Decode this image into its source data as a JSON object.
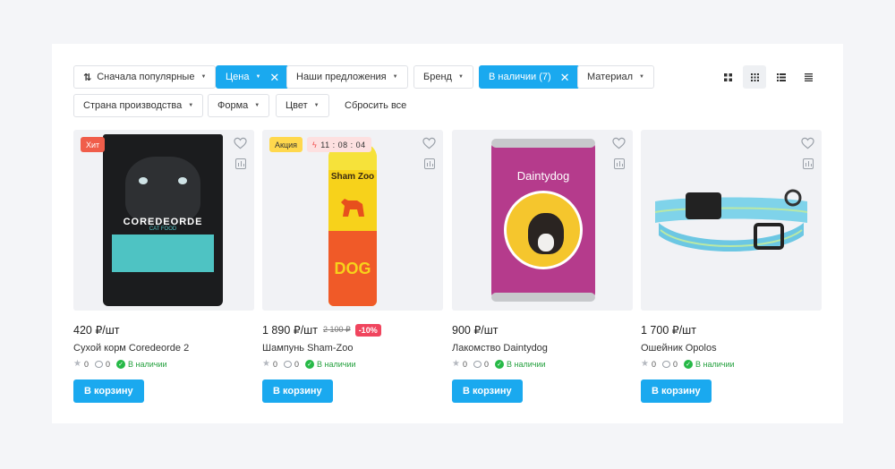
{
  "filters": {
    "sort": {
      "label": "Сначала популярные"
    },
    "price": {
      "label": "Цена"
    },
    "offers": {
      "label": "Наши предложения"
    },
    "brand": {
      "label": "Бренд"
    },
    "stock": {
      "label": "В наличии (7)"
    },
    "material": {
      "label": "Материал"
    },
    "country": {
      "label": "Страна производства"
    },
    "shape": {
      "label": "Форма"
    },
    "color": {
      "label": "Цвет"
    },
    "reset": {
      "label": "Сбросить все"
    }
  },
  "view_modes": [
    "grid-large-icon",
    "grid-small-icon",
    "list-icon",
    "table-icon"
  ],
  "products": [
    {
      "badge": "Хит",
      "price": "420 ₽/шт",
      "name": "Сухой корм Coredeorde 2",
      "rating": "0",
      "reviews": "0",
      "availability": "В наличии",
      "buy": "В корзину",
      "pack_brand": "COREDEORDE",
      "pack_sub": "CAT FOOD"
    },
    {
      "badge": "Акция",
      "timer": "11 : 08 : 04",
      "price": "1 890 ₽/шт",
      "old_price": "2 100 ₽",
      "discount": "-10%",
      "name": "Шампунь Sham-Zoo",
      "rating": "0",
      "reviews": "0",
      "availability": "В наличии",
      "buy": "В корзину",
      "pack_brand": "Sham Zoo",
      "pack_sub": "DOG"
    },
    {
      "price": "900 ₽/шт",
      "name": "Лакомство Daintydog",
      "rating": "0",
      "reviews": "0",
      "availability": "В наличии",
      "buy": "В корзину",
      "pack_brand": "Daintydog"
    },
    {
      "price": "1 700 ₽/шт",
      "name": "Ошейник Opolos",
      "rating": "0",
      "reviews": "0",
      "availability": "В наличии",
      "buy": "В корзину"
    }
  ],
  "colors": {
    "accent": "#1aa9ef",
    "hit": "#f05d4a",
    "sale": "#ffd84d",
    "discount": "#f0455e",
    "in_stock": "#25b946"
  }
}
